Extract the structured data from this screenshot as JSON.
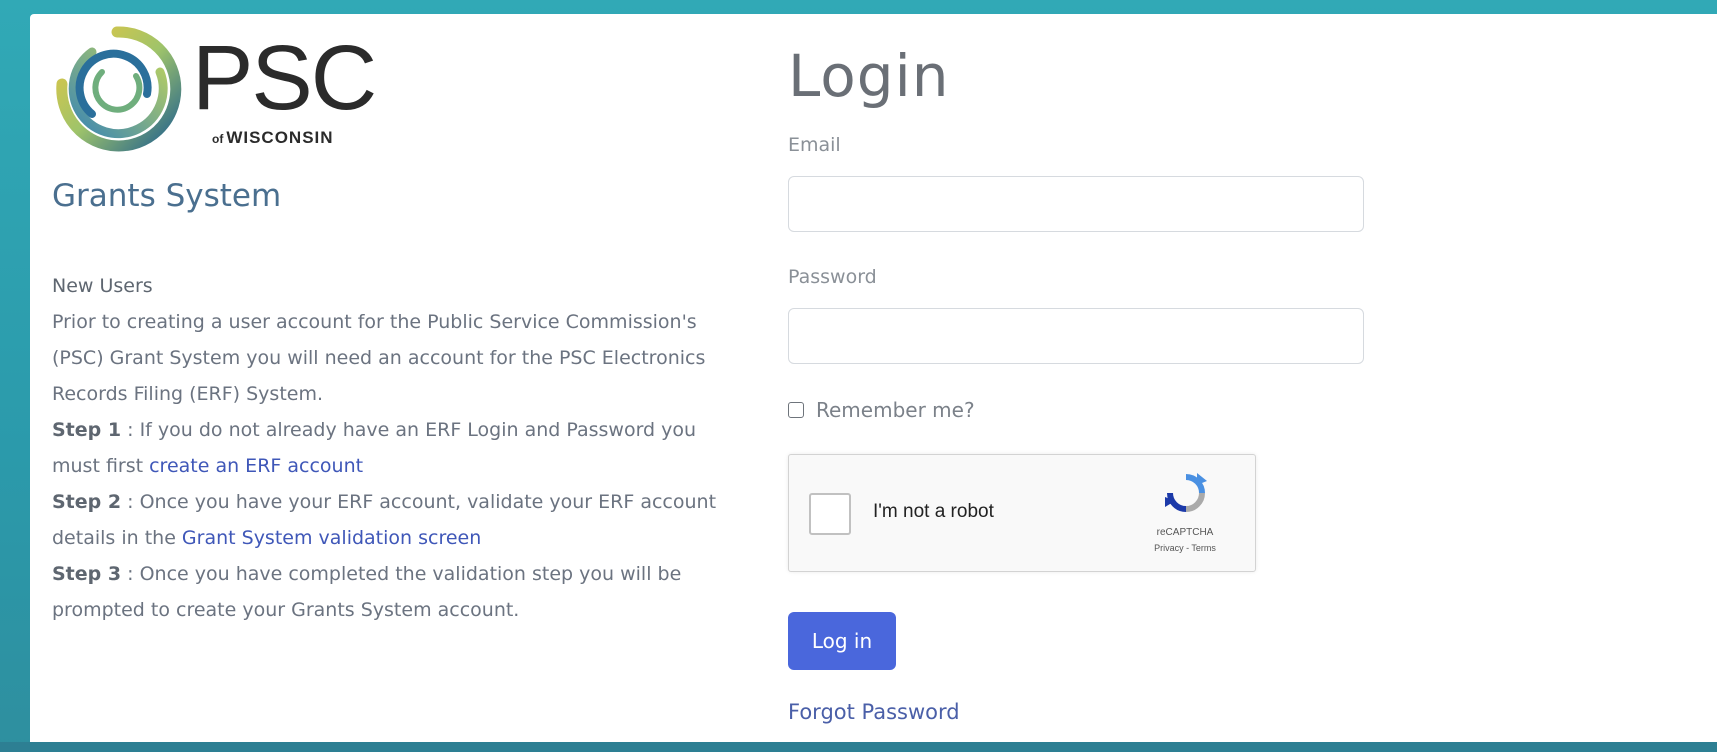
{
  "branding": {
    "logo_text": "PSC",
    "logo_subtext_of": "of",
    "logo_subtext": "WISCONSIN",
    "system_title": "Grants System"
  },
  "info": {
    "heading": "New Users",
    "intro": "Prior to creating a user account for the Public Service Commission's (PSC) Grant System you will need an account for the PSC Electronics Records Filing (ERF) System.",
    "step1_label": "Step 1",
    "step1_text": " : If you do not already have an ERF Login and Password you must first ",
    "step1_link": "create an ERF account",
    "step2_label": "Step 2",
    "step2_text": " : Once you have your ERF account, validate your ERF account details in the ",
    "step2_link": "Grant System validation screen",
    "step3_label": "Step 3",
    "step3_text": " : Once you have completed the validation step you will be prompted to create your Grants System account."
  },
  "login": {
    "title": "Login",
    "email_label": "Email",
    "email_value": "",
    "password_label": "Password",
    "password_value": "",
    "remember_label": "Remember me?",
    "remember_checked": false,
    "login_button": "Log in",
    "forgot_link": "Forgot Password"
  },
  "recaptcha": {
    "label": "I'm not a robot",
    "brand": "reCAPTCHA",
    "links": "Privacy - Terms",
    "icon": "recaptcha-icon"
  },
  "colors": {
    "background": "#2fa3b2",
    "primary_button": "#4a67dc",
    "link": "#3f57b8",
    "title": "#4a6f8f"
  }
}
